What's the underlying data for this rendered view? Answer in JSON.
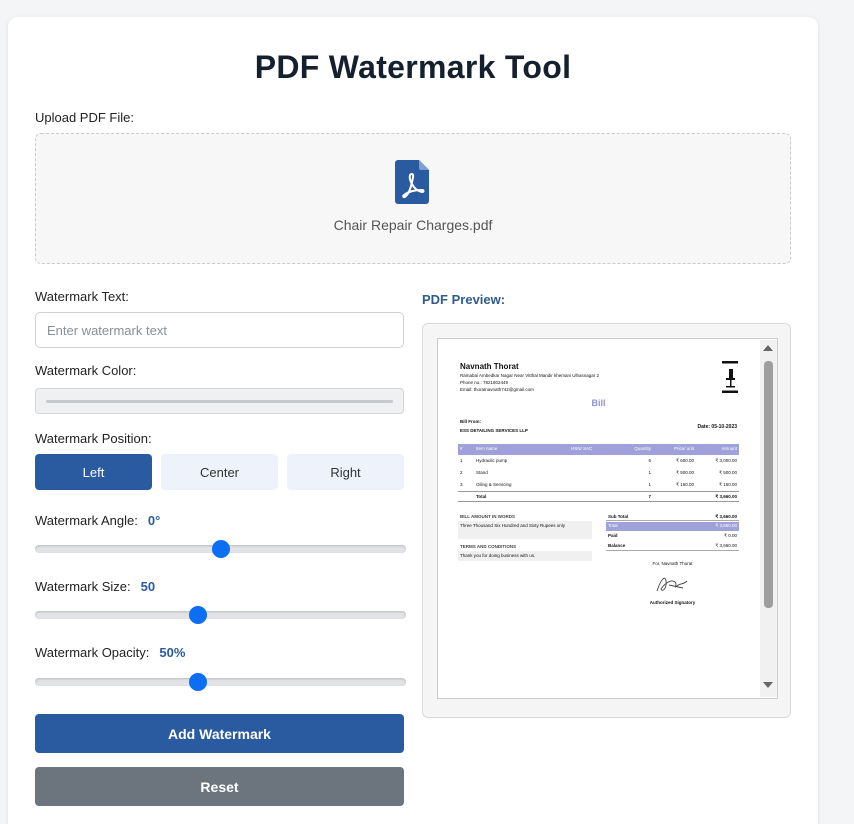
{
  "app": {
    "title": "PDF Watermark Tool",
    "upload_label": "Upload PDF File:",
    "file_icon": "pdf-file-icon",
    "file_name": "Chair Repair Charges.pdf",
    "accent_color": "#2a5aa0",
    "slider_color": "#0b6ef3"
  },
  "controls": {
    "text_label": "Watermark Text:",
    "text_value": "",
    "text_placeholder": "Enter watermark text",
    "color_label": "Watermark Color:",
    "position_label": "Watermark Position:",
    "positions": [
      "Left",
      "Center",
      "Right"
    ],
    "position_selected": "Left",
    "angle_label": "Watermark Angle:",
    "angle_value": "0°",
    "angle_level": 0.5,
    "size_label": "Watermark Size:",
    "size_value": "50",
    "size_level": 0.44,
    "opacity_label": "Watermark Opacity:",
    "opacity_value": "50%",
    "opacity_level": 0.44,
    "add_button": "Add Watermark",
    "reset_button": "Reset"
  },
  "preview": {
    "label": "PDF Preview:",
    "doc": {
      "name": "Navnath Thorat",
      "address": "Ramabai Ambedkar Nagar Near Vitthal Mandir khemani Ulhasnagar 2",
      "phone": "Phone no.: 7821802449",
      "email": "Email: thoratnavnath742@gmail.com",
      "heading": "Bill",
      "bill_from_label": "Bill From:",
      "bill_from": "ESS DETAILING SERVICES LLP",
      "date": "Date: 05-10-2023",
      "columns": [
        "#",
        "Item name",
        "HSN/ SAC",
        "Quantity",
        "Price/ unit",
        "Amount"
      ],
      "rows": [
        [
          "1",
          "Hydraulic pump",
          "",
          "5",
          "₹ 600.00",
          "₹ 3,000.00"
        ],
        [
          "2",
          "Stand",
          "",
          "1",
          "₹ 500.00",
          "₹ 500.00"
        ],
        [
          "3",
          "Oiling & Servicing",
          "",
          "1",
          "₹ 160.00",
          "₹ 160.00"
        ]
      ],
      "total_label": "Total",
      "total_qty": "7",
      "total_amount": "₹ 3,660.00",
      "words_label": "BILL AMOUNT IN WORDS",
      "words": "Three Thousand Six Hundred and Sixty Rupees only",
      "terms_label": "TERMS AND CONDITIONS",
      "terms": "Thank you for doing business with us.",
      "summary": [
        [
          "Sub Total",
          "₹ 3,660.00"
        ],
        [
          "Total",
          "₹ 3,660.00"
        ],
        [
          "Paid",
          "₹ 0.00"
        ],
        [
          "Balance",
          "₹ 3,660.00"
        ]
      ],
      "for_label": "For, Navnath Thorat",
      "signatory": "Authorized Signatory"
    }
  }
}
